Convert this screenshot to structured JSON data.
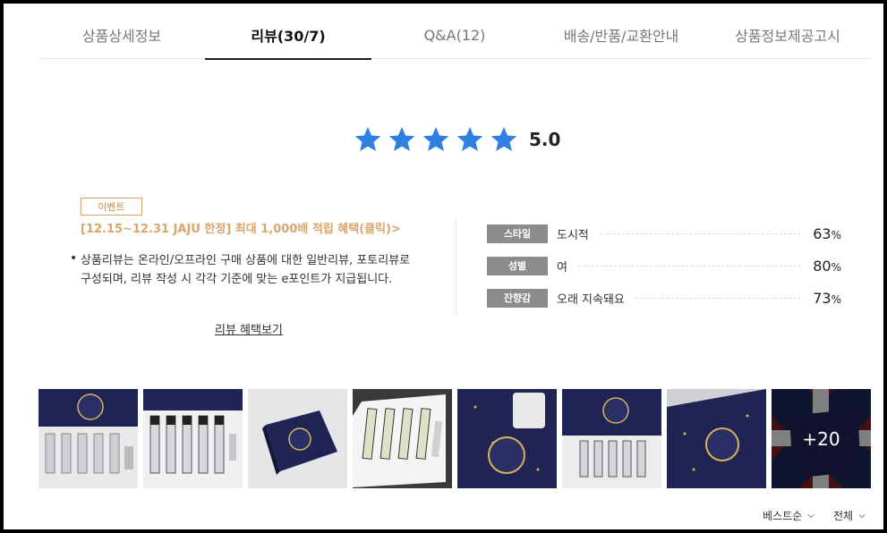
{
  "tabs": [
    {
      "label": "상품상세정보",
      "active": false
    },
    {
      "label": "리뷰(30/7)",
      "active": true
    },
    {
      "label": "Q&A(12)",
      "active": false
    },
    {
      "label": "배송/반품/교환안내",
      "active": false
    },
    {
      "label": "상품정보제공고시",
      "active": false
    }
  ],
  "rating": {
    "score": "5.0",
    "stars": 5,
    "star_color": "#2f80e0"
  },
  "event": {
    "badge": "이벤트",
    "link": "[12.15~12.31 JAJU 한정] 최대 1,000배 적립 혜택(클릭)>",
    "color": "#d9a56c"
  },
  "description": {
    "bullet": "•",
    "text": "상품리뷰는 온라인/오프라인 구매 상품에 대한 일반리뷰, 포토리뷰로 구성되며, 리뷰 작성 시 각각 기준에 맞는 e포인트가 지급됩니다."
  },
  "benefit_link": "리뷰 혜택보기",
  "stats": [
    {
      "label": "스타일",
      "value": "도시적",
      "percent": "63",
      "unit": "%"
    },
    {
      "label": "성별",
      "value": "여",
      "percent": "80",
      "unit": "%"
    },
    {
      "label": "잔향감",
      "value": "오래 지속돼요",
      "percent": "73",
      "unit": "%"
    }
  ],
  "thumbnails": {
    "items": [
      {
        "icon": "product-photo-icon"
      },
      {
        "icon": "product-photo-icon"
      },
      {
        "icon": "product-photo-icon"
      },
      {
        "icon": "product-photo-icon"
      },
      {
        "icon": "product-photo-icon"
      },
      {
        "icon": "product-photo-icon"
      },
      {
        "icon": "product-photo-icon"
      },
      {
        "icon": "product-photo-icon"
      }
    ],
    "more_label": "+20"
  },
  "sort": {
    "order": "베스트순",
    "filter": "전체"
  }
}
